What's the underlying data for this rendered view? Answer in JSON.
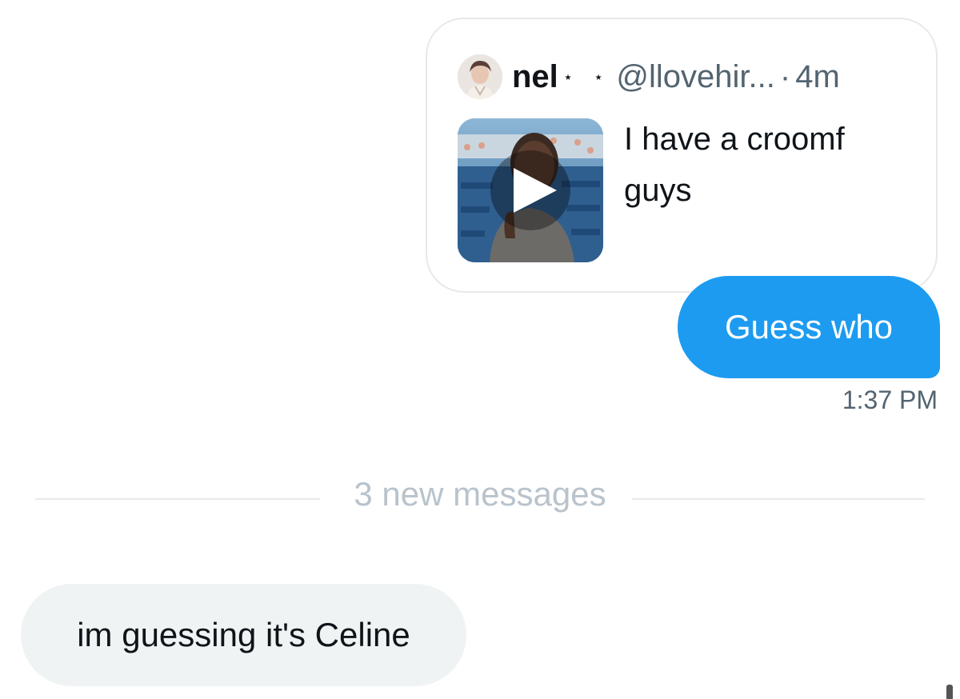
{
  "quote": {
    "name": "nel",
    "stars": "⋆ ⋆",
    "handle": "@llovehir...",
    "separator": "·",
    "time": "4m",
    "text": "I have a croomf guys"
  },
  "outgoing": {
    "text": "Guess who",
    "time": "1:37 PM"
  },
  "divider": {
    "label": "3 new messages"
  },
  "incoming": {
    "text": "im guessing it's Celine"
  },
  "colors": {
    "accent": "#1d9bf0",
    "incoming_bg": "#eff3f4",
    "muted": "#536471"
  }
}
